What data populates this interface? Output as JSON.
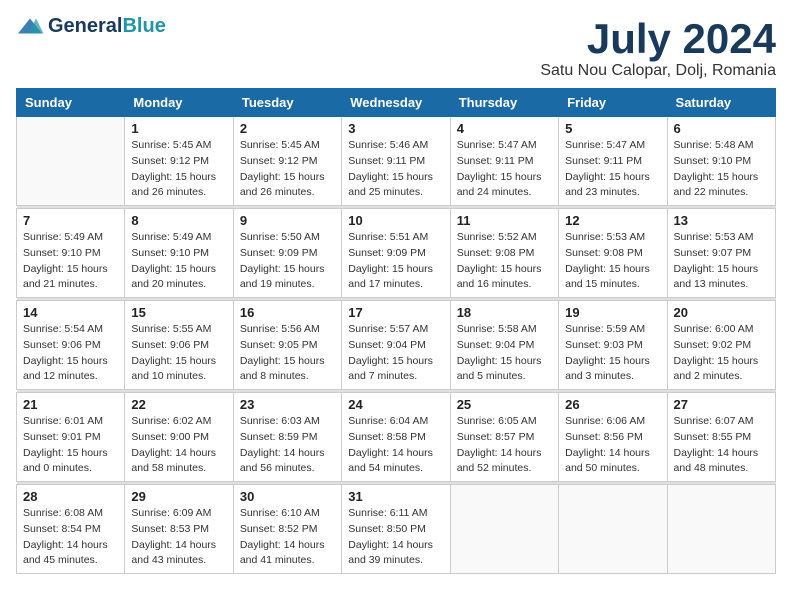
{
  "header": {
    "logo": {
      "part1": "General",
      "part2": "Blue"
    },
    "title": "July 2024",
    "location": "Satu Nou Calopar, Dolj, Romania"
  },
  "days_of_week": [
    "Sunday",
    "Monday",
    "Tuesday",
    "Wednesday",
    "Thursday",
    "Friday",
    "Saturday"
  ],
  "weeks": [
    [
      {
        "day": "",
        "info": ""
      },
      {
        "day": "1",
        "info": "Sunrise: 5:45 AM\nSunset: 9:12 PM\nDaylight: 15 hours\nand 26 minutes."
      },
      {
        "day": "2",
        "info": "Sunrise: 5:45 AM\nSunset: 9:12 PM\nDaylight: 15 hours\nand 26 minutes."
      },
      {
        "day": "3",
        "info": "Sunrise: 5:46 AM\nSunset: 9:11 PM\nDaylight: 15 hours\nand 25 minutes."
      },
      {
        "day": "4",
        "info": "Sunrise: 5:47 AM\nSunset: 9:11 PM\nDaylight: 15 hours\nand 24 minutes."
      },
      {
        "day": "5",
        "info": "Sunrise: 5:47 AM\nSunset: 9:11 PM\nDaylight: 15 hours\nand 23 minutes."
      },
      {
        "day": "6",
        "info": "Sunrise: 5:48 AM\nSunset: 9:10 PM\nDaylight: 15 hours\nand 22 minutes."
      }
    ],
    [
      {
        "day": "7",
        "info": "Sunrise: 5:49 AM\nSunset: 9:10 PM\nDaylight: 15 hours\nand 21 minutes."
      },
      {
        "day": "8",
        "info": "Sunrise: 5:49 AM\nSunset: 9:10 PM\nDaylight: 15 hours\nand 20 minutes."
      },
      {
        "day": "9",
        "info": "Sunrise: 5:50 AM\nSunset: 9:09 PM\nDaylight: 15 hours\nand 19 minutes."
      },
      {
        "day": "10",
        "info": "Sunrise: 5:51 AM\nSunset: 9:09 PM\nDaylight: 15 hours\nand 17 minutes."
      },
      {
        "day": "11",
        "info": "Sunrise: 5:52 AM\nSunset: 9:08 PM\nDaylight: 15 hours\nand 16 minutes."
      },
      {
        "day": "12",
        "info": "Sunrise: 5:53 AM\nSunset: 9:08 PM\nDaylight: 15 hours\nand 15 minutes."
      },
      {
        "day": "13",
        "info": "Sunrise: 5:53 AM\nSunset: 9:07 PM\nDaylight: 15 hours\nand 13 minutes."
      }
    ],
    [
      {
        "day": "14",
        "info": "Sunrise: 5:54 AM\nSunset: 9:06 PM\nDaylight: 15 hours\nand 12 minutes."
      },
      {
        "day": "15",
        "info": "Sunrise: 5:55 AM\nSunset: 9:06 PM\nDaylight: 15 hours\nand 10 minutes."
      },
      {
        "day": "16",
        "info": "Sunrise: 5:56 AM\nSunset: 9:05 PM\nDaylight: 15 hours\nand 8 minutes."
      },
      {
        "day": "17",
        "info": "Sunrise: 5:57 AM\nSunset: 9:04 PM\nDaylight: 15 hours\nand 7 minutes."
      },
      {
        "day": "18",
        "info": "Sunrise: 5:58 AM\nSunset: 9:04 PM\nDaylight: 15 hours\nand 5 minutes."
      },
      {
        "day": "19",
        "info": "Sunrise: 5:59 AM\nSunset: 9:03 PM\nDaylight: 15 hours\nand 3 minutes."
      },
      {
        "day": "20",
        "info": "Sunrise: 6:00 AM\nSunset: 9:02 PM\nDaylight: 15 hours\nand 2 minutes."
      }
    ],
    [
      {
        "day": "21",
        "info": "Sunrise: 6:01 AM\nSunset: 9:01 PM\nDaylight: 15 hours\nand 0 minutes."
      },
      {
        "day": "22",
        "info": "Sunrise: 6:02 AM\nSunset: 9:00 PM\nDaylight: 14 hours\nand 58 minutes."
      },
      {
        "day": "23",
        "info": "Sunrise: 6:03 AM\nSunset: 8:59 PM\nDaylight: 14 hours\nand 56 minutes."
      },
      {
        "day": "24",
        "info": "Sunrise: 6:04 AM\nSunset: 8:58 PM\nDaylight: 14 hours\nand 54 minutes."
      },
      {
        "day": "25",
        "info": "Sunrise: 6:05 AM\nSunset: 8:57 PM\nDaylight: 14 hours\nand 52 minutes."
      },
      {
        "day": "26",
        "info": "Sunrise: 6:06 AM\nSunset: 8:56 PM\nDaylight: 14 hours\nand 50 minutes."
      },
      {
        "day": "27",
        "info": "Sunrise: 6:07 AM\nSunset: 8:55 PM\nDaylight: 14 hours\nand 48 minutes."
      }
    ],
    [
      {
        "day": "28",
        "info": "Sunrise: 6:08 AM\nSunset: 8:54 PM\nDaylight: 14 hours\nand 45 minutes."
      },
      {
        "day": "29",
        "info": "Sunrise: 6:09 AM\nSunset: 8:53 PM\nDaylight: 14 hours\nand 43 minutes."
      },
      {
        "day": "30",
        "info": "Sunrise: 6:10 AM\nSunset: 8:52 PM\nDaylight: 14 hours\nand 41 minutes."
      },
      {
        "day": "31",
        "info": "Sunrise: 6:11 AM\nSunset: 8:50 PM\nDaylight: 14 hours\nand 39 minutes."
      },
      {
        "day": "",
        "info": ""
      },
      {
        "day": "",
        "info": ""
      },
      {
        "day": "",
        "info": ""
      }
    ]
  ]
}
